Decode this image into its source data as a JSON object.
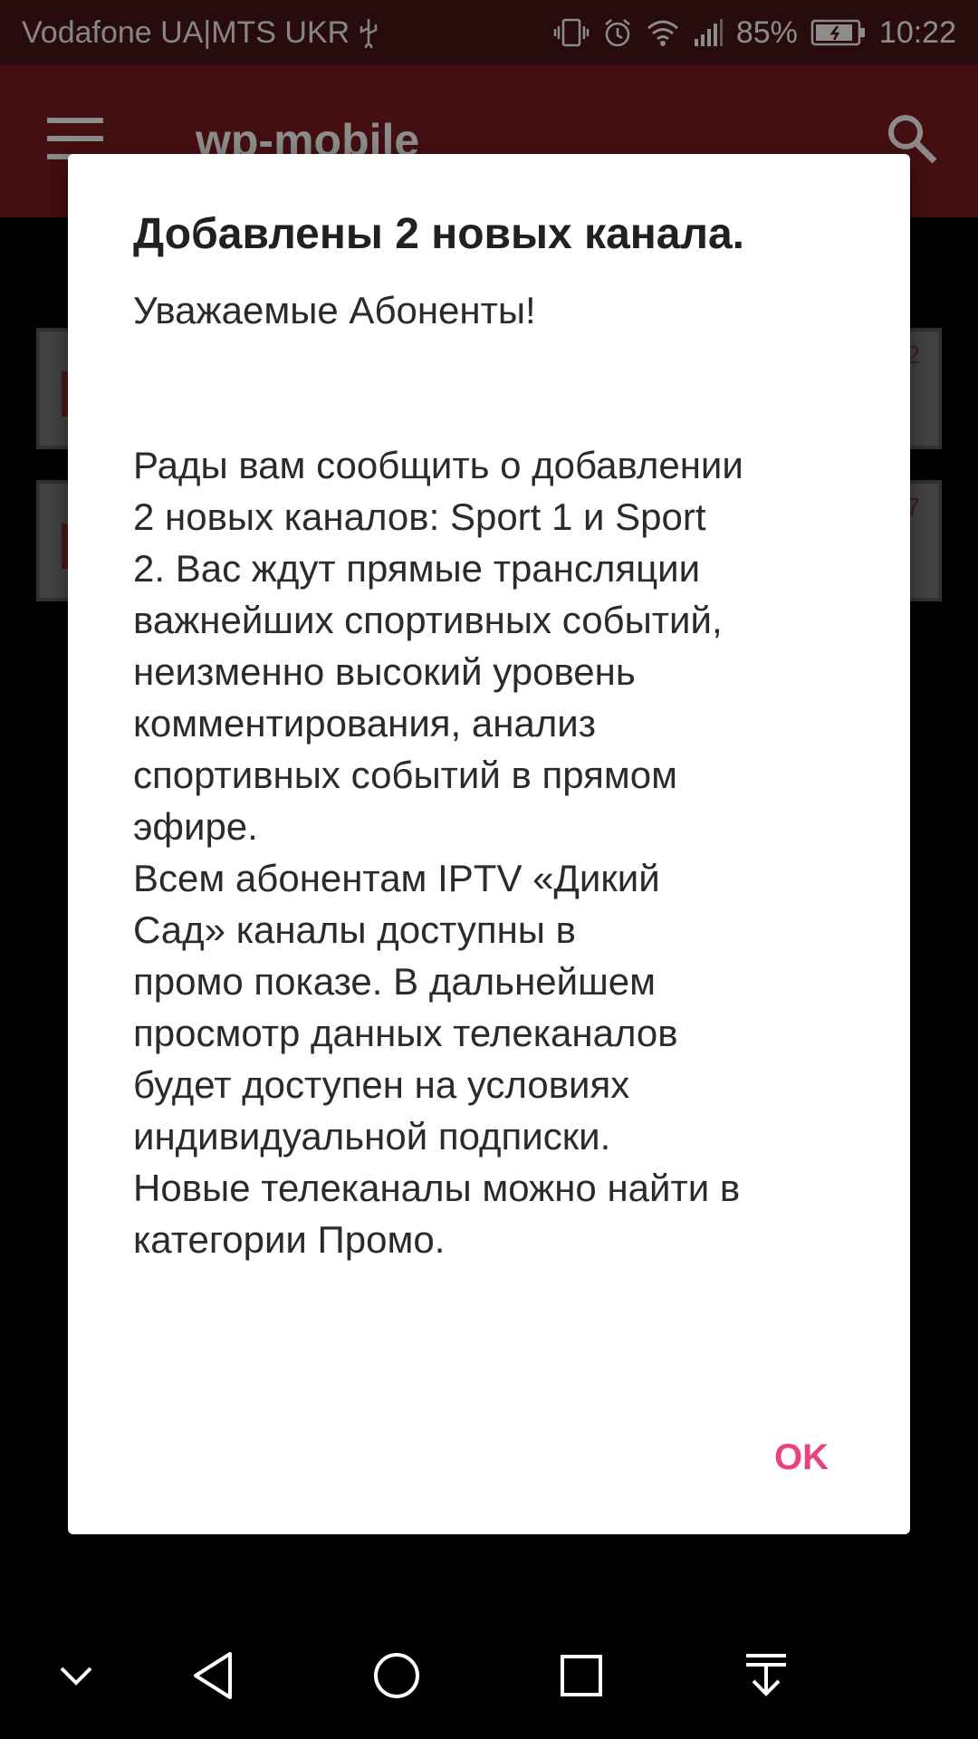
{
  "status_bar": {
    "carrier": "Vodafone UA|MTS UKR",
    "battery": "85%",
    "time": "10:22",
    "icons": [
      "usb-icon",
      "vibrate-icon",
      "alarm-icon",
      "wifi-icon",
      "signal-icon",
      "battery-icon"
    ]
  },
  "app_bar": {
    "title": "wp-mobile",
    "icons": [
      "menu-icon",
      "search-icon"
    ]
  },
  "background_cards": [
    {
      "number": "2"
    },
    {
      "number": "7"
    }
  ],
  "dialog": {
    "title": "Добавлены 2 новых канала.",
    "body": "Уважаемые Абоненты!\n\n\nРады вам сообщить о добавлении\n2 новых каналов: Sport 1 и Sport\n2. Вас ждут прямые трансляции\nважнейших спортивных событий,\nнеизменно высокий уровень\nкомментирования, анализ\nспортивных событий в прямом\nэфире.\nВсем абонентам IPTV «Дикий\nСад» каналы доступны в\nпромо показе. В дальнейшем\nпросмотр данных телеканалов\nбудет доступен на условиях\nиндивидуальной подписки.\nНовые телеканалы можно найти в\nкатегории Промо.",
    "ok_label": "OK",
    "accent_color": "#e8437a"
  },
  "nav_bar": {
    "icons": [
      "collapse-icon",
      "back-icon",
      "home-icon",
      "recents-icon",
      "notifications-pulldown-icon"
    ]
  },
  "colors": {
    "status_bar": "#4a1416",
    "app_bar": "#7b1c1f"
  }
}
